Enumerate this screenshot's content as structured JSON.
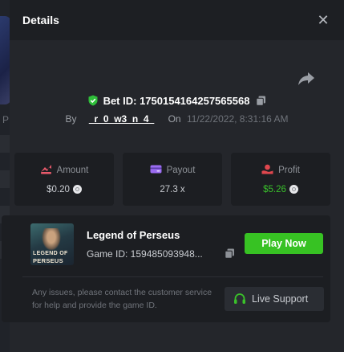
{
  "modal": {
    "title": "Details"
  },
  "bet": {
    "id_label": "Bet ID: 1750154164257565568",
    "by_label": "By",
    "username": "_r_0_w3_n_4_",
    "on_label": "On",
    "datetime": "11/22/2022, 8:31:16 AM"
  },
  "stats": {
    "amount": {
      "label": "Amount",
      "value": "$0.20",
      "color": "#e85a6b"
    },
    "payout": {
      "label": "Payout",
      "value": "27.3 x",
      "color": "#9b6cf2"
    },
    "profit": {
      "label": "Profit",
      "value": "$5.26",
      "color": "#e0474e",
      "value_color": "#39c02b"
    }
  },
  "game": {
    "name": "Legend of Perseus",
    "id_label": "Game ID: 159485093948...",
    "thumb_line1": "LEGEND OF",
    "thumb_line2": "PERSEUS",
    "play_label": "Play Now",
    "play_color": "#37c223"
  },
  "support": {
    "notice": "Any issues, please contact the customer service for help and provide the game ID.",
    "button_label": "Live Support",
    "icon_color": "#3ac22a"
  },
  "backdrop": {
    "fragment_text": "P"
  },
  "icons": [
    "close-icon",
    "share-icon",
    "shield-check-icon",
    "copy-icon",
    "amount-icon",
    "payout-icon",
    "profit-icon",
    "coin-icon",
    "headset-icon"
  ]
}
